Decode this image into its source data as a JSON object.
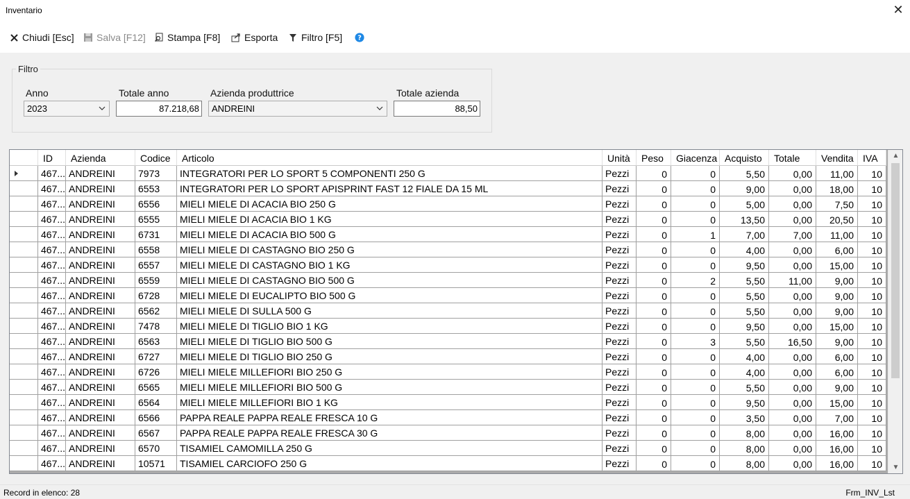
{
  "window": {
    "title": "Inventario"
  },
  "toolbar": {
    "close_label": "Chiudi [Esc]",
    "save_label": "Salva [F12]",
    "print_label": "Stampa [F8]",
    "export_label": "Esporta",
    "filter_label": "Filtro [F5]"
  },
  "filter": {
    "legend": "Filtro",
    "year_label": "Anno",
    "year_value": "2023",
    "year_total_label": "Totale anno",
    "year_total_value": "87.218,68",
    "producer_label": "Azienda produttrice",
    "producer_value": "ANDREINI",
    "producer_total_label": "Totale azienda",
    "producer_total_value": "88,50"
  },
  "grid": {
    "columns": [
      "",
      "ID",
      "Azienda",
      "Codice",
      "Articolo",
      "Unità",
      "Peso",
      "Giacenza",
      "Acquisto",
      "Totale",
      "Vendita",
      "IVA"
    ],
    "rows": [
      [
        "467...",
        "ANDREINI",
        "7973",
        "INTEGRATORI PER LO SPORT 5 COMPONENTI 250 G",
        "Pezzi",
        "0",
        "0",
        "5,50",
        "0,00",
        "11,00",
        "10"
      ],
      [
        "467...",
        "ANDREINI",
        "6553",
        "INTEGRATORI PER LO SPORT APISPRINT FAST 12 FIALE DA 15 ML",
        "Pezzi",
        "0",
        "0",
        "9,00",
        "0,00",
        "18,00",
        "10"
      ],
      [
        "467...",
        "ANDREINI",
        "6556",
        "MIELI MIELE DI ACACIA BIO 250 G",
        "Pezzi",
        "0",
        "0",
        "5,00",
        "0,00",
        "7,50",
        "10"
      ],
      [
        "467...",
        "ANDREINI",
        "6555",
        "MIELI MIELE DI ACACIA BIO 1 KG",
        "Pezzi",
        "0",
        "0",
        "13,50",
        "0,00",
        "20,50",
        "10"
      ],
      [
        "467...",
        "ANDREINI",
        "6731",
        "MIELI MIELE DI ACACIA BIO 500 G",
        "Pezzi",
        "0",
        "1",
        "7,00",
        "7,00",
        "11,00",
        "10"
      ],
      [
        "467...",
        "ANDREINI",
        "6558",
        "MIELI MIELE DI CASTAGNO BIO 250 G",
        "Pezzi",
        "0",
        "0",
        "4,00",
        "0,00",
        "6,00",
        "10"
      ],
      [
        "467...",
        "ANDREINI",
        "6557",
        "MIELI MIELE DI CASTAGNO BIO 1 KG",
        "Pezzi",
        "0",
        "0",
        "9,50",
        "0,00",
        "15,00",
        "10"
      ],
      [
        "467...",
        "ANDREINI",
        "6559",
        "MIELI MIELE DI CASTAGNO BIO 500 G",
        "Pezzi",
        "0",
        "2",
        "5,50",
        "11,00",
        "9,00",
        "10"
      ],
      [
        "467...",
        "ANDREINI",
        "6728",
        "MIELI MIELE DI EUCALIPTO BIO 500 G",
        "Pezzi",
        "0",
        "0",
        "5,50",
        "0,00",
        "9,00",
        "10"
      ],
      [
        "467...",
        "ANDREINI",
        "6562",
        "MIELI MIELE DI SULLA 500 G",
        "Pezzi",
        "0",
        "0",
        "5,50",
        "0,00",
        "9,00",
        "10"
      ],
      [
        "467...",
        "ANDREINI",
        "7478",
        "MIELI MIELE DI TIGLIO BIO 1 KG",
        "Pezzi",
        "0",
        "0",
        "9,50",
        "0,00",
        "15,00",
        "10"
      ],
      [
        "467...",
        "ANDREINI",
        "6563",
        "MIELI MIELE DI TIGLIO BIO 500 G",
        "Pezzi",
        "0",
        "3",
        "5,50",
        "16,50",
        "9,00",
        "10"
      ],
      [
        "467...",
        "ANDREINI",
        "6727",
        "MIELI MIELE DI TIGLIO BIO 250 G",
        "Pezzi",
        "0",
        "0",
        "4,00",
        "0,00",
        "6,00",
        "10"
      ],
      [
        "467...",
        "ANDREINI",
        "6726",
        "MIELI MIELE MILLEFIORI BIO 250 G",
        "Pezzi",
        "0",
        "0",
        "4,00",
        "0,00",
        "6,00",
        "10"
      ],
      [
        "467...",
        "ANDREINI",
        "6565",
        "MIELI MIELE MILLEFIORI BIO 500 G",
        "Pezzi",
        "0",
        "0",
        "5,50",
        "0,00",
        "9,00",
        "10"
      ],
      [
        "467...",
        "ANDREINI",
        "6564",
        "MIELI MIELE MILLEFIORI BIO 1 KG",
        "Pezzi",
        "0",
        "0",
        "9,50",
        "0,00",
        "15,00",
        "10"
      ],
      [
        "467...",
        "ANDREINI",
        "6566",
        "PAPPA REALE PAPPA REALE FRESCA 10 G",
        "Pezzi",
        "0",
        "0",
        "3,50",
        "0,00",
        "7,00",
        "10"
      ],
      [
        "467...",
        "ANDREINI",
        "6567",
        "PAPPA REALE PAPPA REALE FRESCA 30 G",
        "Pezzi",
        "0",
        "0",
        "8,00",
        "0,00",
        "16,00",
        "10"
      ],
      [
        "467...",
        "ANDREINI",
        "6570",
        "TISAMIEL CAMOMILLA 250 G",
        "Pezzi",
        "0",
        "0",
        "8,00",
        "0,00",
        "16,00",
        "10"
      ],
      [
        "467...",
        "ANDREINI",
        "10571",
        "TISAMIEL CARCIOFO 250 G",
        "Pezzi",
        "0",
        "0",
        "8,00",
        "0,00",
        "16,00",
        "10"
      ]
    ]
  },
  "status": {
    "records": "Record in elenco: 28",
    "form_name": "Frm_INV_Lst"
  },
  "icons": {
    "close": "x-icon",
    "save": "floppy-disk-icon",
    "print": "print-preview-icon",
    "export": "export-icon",
    "filter": "funnel-icon",
    "help": "help-circle-icon"
  },
  "colors": {
    "help_blue": "#1e88e5",
    "grid_background": "#ababab",
    "panel": "#f0f0f0"
  }
}
